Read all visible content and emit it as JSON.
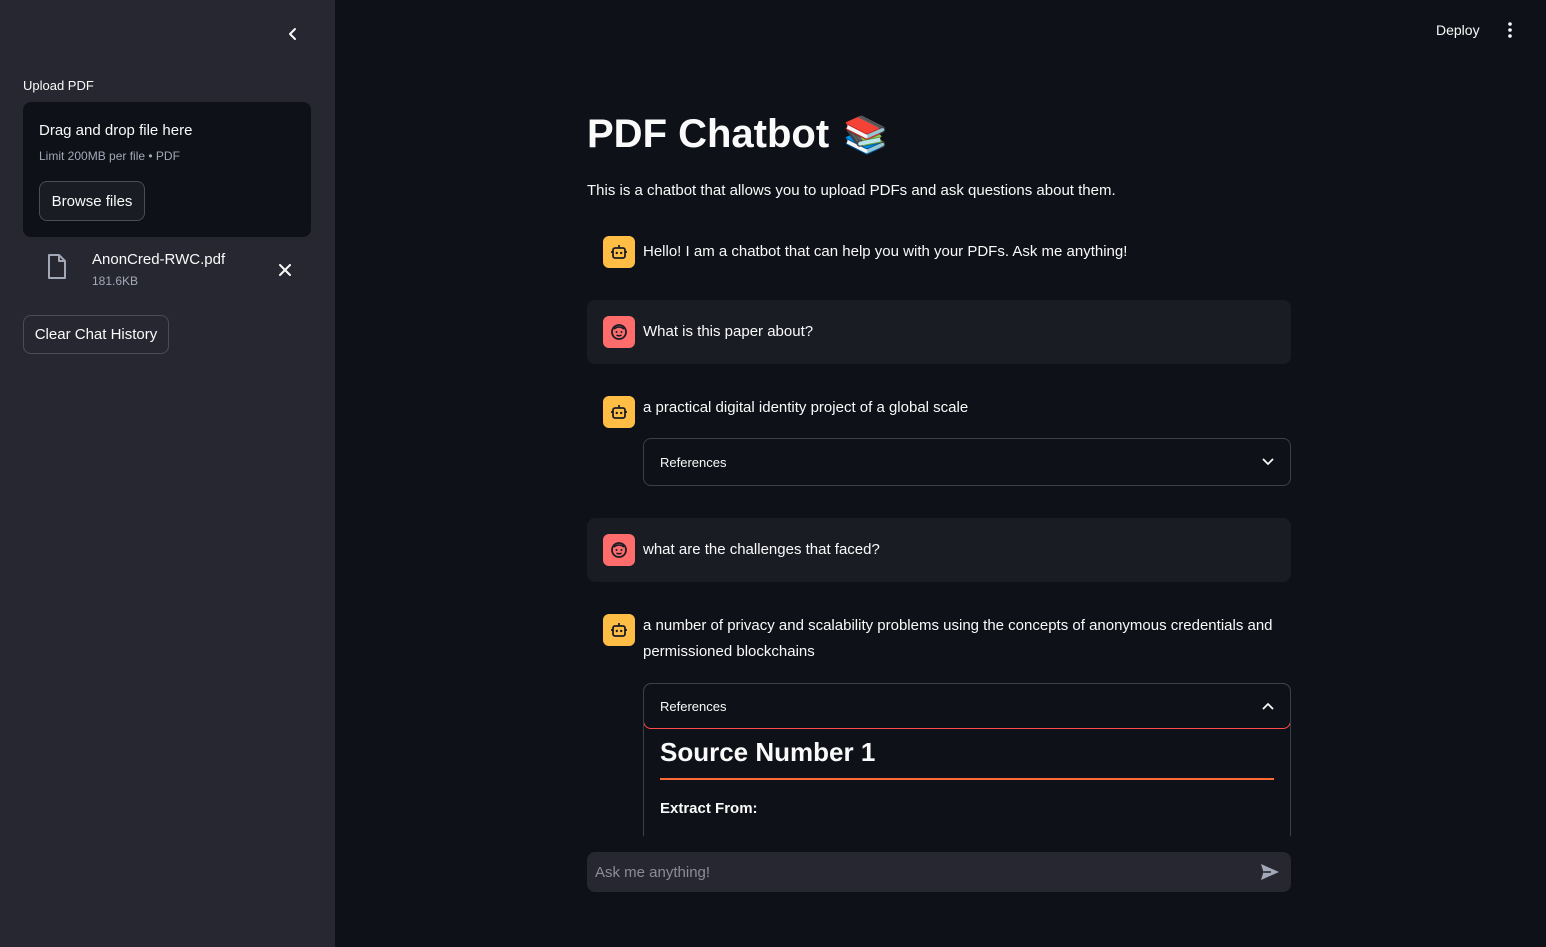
{
  "sidebar": {
    "upload_label": "Upload PDF",
    "dropzone_title": "Drag and drop file here",
    "dropzone_limit": "Limit 200MB per file • PDF",
    "browse_label": "Browse files",
    "file": {
      "name": "AnonCred-RWC.pdf",
      "size": "181.6KB"
    },
    "clear_label": "Clear Chat History"
  },
  "header": {
    "deploy_label": "Deploy"
  },
  "main": {
    "title": "PDF Chatbot",
    "title_emoji": "📚",
    "subtitle": "This is a chatbot that allows you to upload PDFs and ask questions about them.",
    "messages": [
      {
        "role": "assistant",
        "text": "Hello! I am a chatbot that can help you with your PDFs. Ask me anything!"
      },
      {
        "role": "user",
        "text": "What is this paper about?"
      },
      {
        "role": "assistant",
        "text": "a practical digital identity project of a global scale",
        "expander": "References"
      },
      {
        "role": "user",
        "text": "what are the challenges that faced?"
      },
      {
        "role": "assistant",
        "text": "a number of privacy and scalability problems using the concepts of anonymous credentials and permissioned blockchains",
        "expander": "References"
      }
    ],
    "source_title": "Source Number 1",
    "extract_label": "Extract From:"
  },
  "chat_input": {
    "placeholder": "Ask me anything!"
  },
  "colors": {
    "bot_avatar": "#ffbd45",
    "user_avatar": "#ff6c6c",
    "accent": "#ff4b4b"
  }
}
